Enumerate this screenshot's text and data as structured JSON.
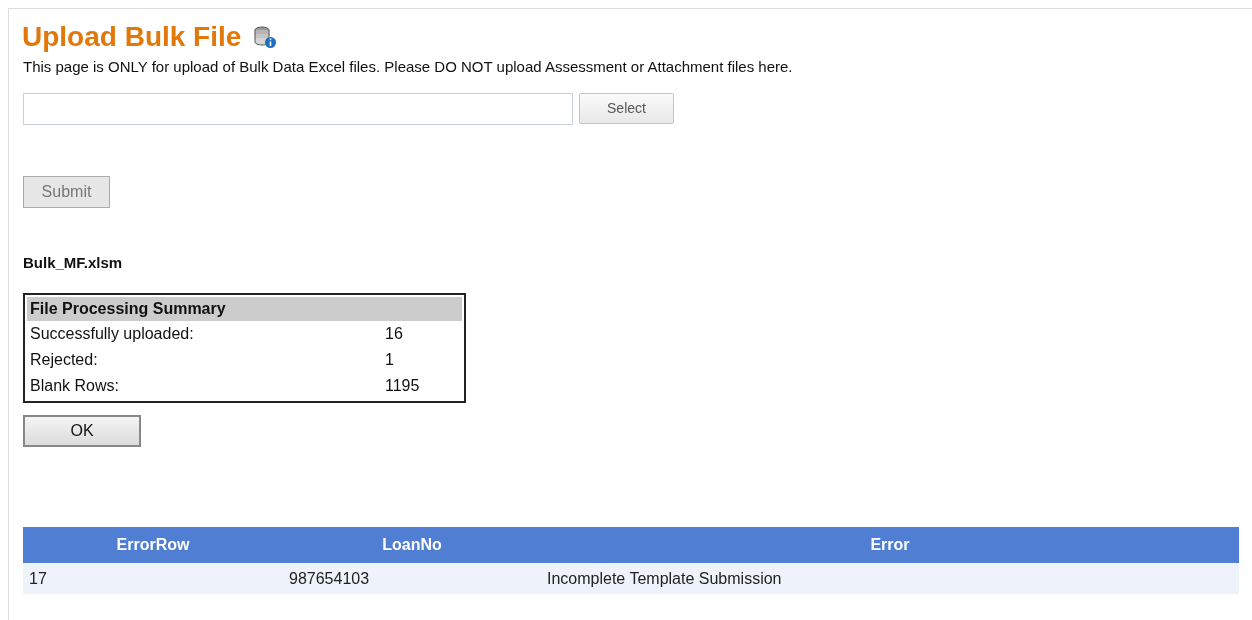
{
  "page": {
    "title": "Upload Bulk File",
    "notice": "This page is ONLY for upload of Bulk Data Excel files. Please DO NOT upload Assessment or Attachment files here."
  },
  "upload": {
    "select_button": "Select",
    "submit_button": {
      "label": "Submit",
      "disabled": true
    }
  },
  "file_name": "Bulk_MF.xlsm",
  "summary": {
    "title": "File Processing Summary",
    "rows": [
      {
        "label": "Successfully uploaded:",
        "value": "16"
      },
      {
        "label": "Rejected:",
        "value": "1"
      },
      {
        "label": "Blank Rows:",
        "value": "1195"
      }
    ],
    "ok_button": "OK"
  },
  "error_table": {
    "columns": [
      "ErrorRow",
      "LoanNo",
      "Error"
    ],
    "rows": [
      [
        "17",
        "987654103",
        "Incomplete Template Submission"
      ]
    ]
  }
}
